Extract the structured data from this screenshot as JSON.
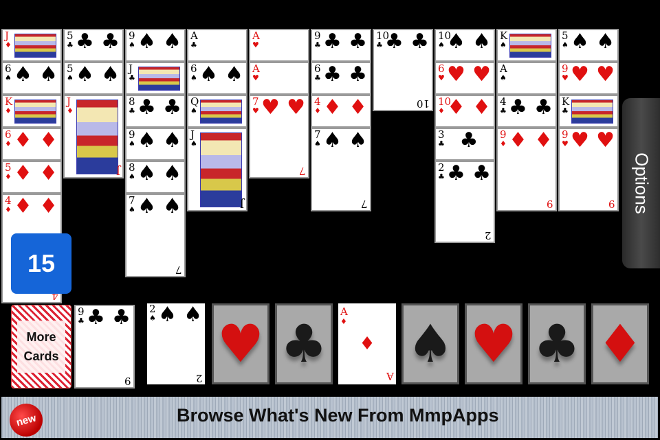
{
  "tableau": [
    {
      "cards": [
        {
          "rank": "J",
          "suit": "♦",
          "color": "red"
        },
        {
          "rank": "6",
          "suit": "♠",
          "color": "black"
        },
        {
          "rank": "K",
          "suit": "♦",
          "color": "red"
        },
        {
          "rank": "6",
          "suit": "♦",
          "color": "red"
        },
        {
          "rank": "5",
          "suit": "♦",
          "color": "red"
        },
        {
          "rank": "4",
          "suit": "♦",
          "color": "red"
        }
      ]
    },
    {
      "cards": [
        {
          "rank": "5",
          "suit": "♣",
          "color": "black"
        },
        {
          "rank": "5",
          "suit": "♠",
          "color": "black"
        },
        {
          "rank": "J",
          "suit": "♦",
          "color": "red"
        }
      ]
    },
    {
      "cards": [
        {
          "rank": "9",
          "suit": "♠",
          "color": "black"
        },
        {
          "rank": "J",
          "suit": "♣",
          "color": "black"
        },
        {
          "rank": "8",
          "suit": "♣",
          "color": "black"
        },
        {
          "rank": "9",
          "suit": "♠",
          "color": "black"
        },
        {
          "rank": "8",
          "suit": "♠",
          "color": "black"
        },
        {
          "rank": "7",
          "suit": "♠",
          "color": "black"
        }
      ]
    },
    {
      "cards": [
        {
          "rank": "A",
          "suit": "♣",
          "color": "black"
        },
        {
          "rank": "6",
          "suit": "♠",
          "color": "black"
        },
        {
          "rank": "Q",
          "suit": "♠",
          "color": "black"
        },
        {
          "rank": "J",
          "suit": "♠",
          "color": "black"
        }
      ]
    },
    {
      "cards": [
        {
          "rank": "A",
          "suit": "♥",
          "color": "red"
        },
        {
          "rank": "A",
          "suit": "♥",
          "color": "red"
        },
        {
          "rank": "7",
          "suit": "♥",
          "color": "red"
        }
      ]
    },
    {
      "cards": [
        {
          "rank": "9",
          "suit": "♣",
          "color": "black"
        },
        {
          "rank": "6",
          "suit": "♣",
          "color": "black"
        },
        {
          "rank": "4",
          "suit": "♦",
          "color": "red"
        },
        {
          "rank": "7",
          "suit": "♠",
          "color": "black"
        }
      ]
    },
    {
      "cards": [
        {
          "rank": "10",
          "suit": "♣",
          "color": "black"
        }
      ]
    },
    {
      "cards": [
        {
          "rank": "10",
          "suit": "♠",
          "color": "black"
        },
        {
          "rank": "6",
          "suit": "♥",
          "color": "red"
        },
        {
          "rank": "10",
          "suit": "♦",
          "color": "red"
        },
        {
          "rank": "3",
          "suit": "♣",
          "color": "black"
        },
        {
          "rank": "2",
          "suit": "♣",
          "color": "black"
        }
      ]
    },
    {
      "cards": [
        {
          "rank": "K",
          "suit": "♠",
          "color": "black"
        },
        {
          "rank": "A",
          "suit": "♠",
          "color": "black"
        },
        {
          "rank": "4",
          "suit": "♣",
          "color": "black"
        },
        {
          "rank": "9",
          "suit": "♦",
          "color": "red"
        }
      ]
    },
    {
      "cards": [
        {
          "rank": "5",
          "suit": "♠",
          "color": "black"
        },
        {
          "rank": "9",
          "suit": "♥",
          "color": "red"
        },
        {
          "rank": "K",
          "suit": "♣",
          "color": "black"
        },
        {
          "rank": "9",
          "suit": "♥",
          "color": "red"
        }
      ]
    }
  ],
  "counter": "15",
  "options_label": "Options",
  "stock": {
    "label_line1": "More",
    "label_line2": "Cards"
  },
  "waste": [
    {
      "rank": "9",
      "suit": "♣",
      "color": "black"
    },
    {
      "rank": "2",
      "suit": "♠",
      "color": "black"
    }
  ],
  "foundations": [
    {
      "type": "empty",
      "suit": "♥",
      "color": "red"
    },
    {
      "type": "empty",
      "suit": "♣",
      "color": "black"
    },
    {
      "type": "card",
      "rank": "A",
      "suit": "♦",
      "color": "red"
    },
    {
      "type": "empty",
      "suit": "♠",
      "color": "black"
    },
    {
      "type": "empty",
      "suit": "♥",
      "color": "red"
    },
    {
      "type": "empty",
      "suit": "♣",
      "color": "black"
    },
    {
      "type": "empty",
      "suit": "♦",
      "color": "red"
    }
  ],
  "banner": {
    "badge": "new",
    "text": "Browse What's New From MmpApps"
  },
  "colors": {
    "counter_bg": "#1565d8",
    "red_suit": "#e01010",
    "table_bg": "#000000"
  }
}
